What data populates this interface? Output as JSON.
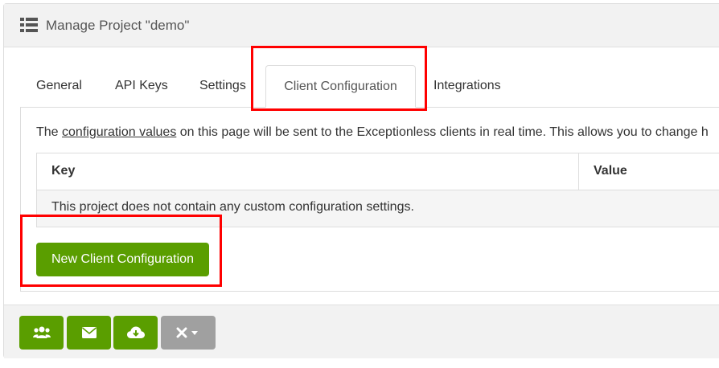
{
  "header": {
    "icon": "list-icon",
    "title": "Manage Project \"demo\""
  },
  "tabs": [
    {
      "label": "General",
      "active": false
    },
    {
      "label": "API Keys",
      "active": false
    },
    {
      "label": "Settings",
      "active": false
    },
    {
      "label": "Client Configuration",
      "active": true
    },
    {
      "label": "Integrations",
      "active": false
    }
  ],
  "description": {
    "prefix": "The ",
    "link": "configuration values",
    "suffix": " on this page will be sent to the Exceptionless clients in real time. This allows you to change h"
  },
  "table": {
    "columns": [
      "Key",
      "Value"
    ],
    "empty_message": "This project does not contain any custom configuration settings."
  },
  "new_button_label": "New Client Configuration",
  "footer": {
    "buttons": [
      {
        "icon": "users-icon"
      },
      {
        "icon": "envelope-icon"
      },
      {
        "icon": "cloud-download-icon"
      },
      {
        "icon": "close-dropdown-icon"
      }
    ]
  },
  "colors": {
    "primary_green": "#5a9e00",
    "annotation_red": "#ff0000",
    "grey_button": "#a0a0a0"
  }
}
